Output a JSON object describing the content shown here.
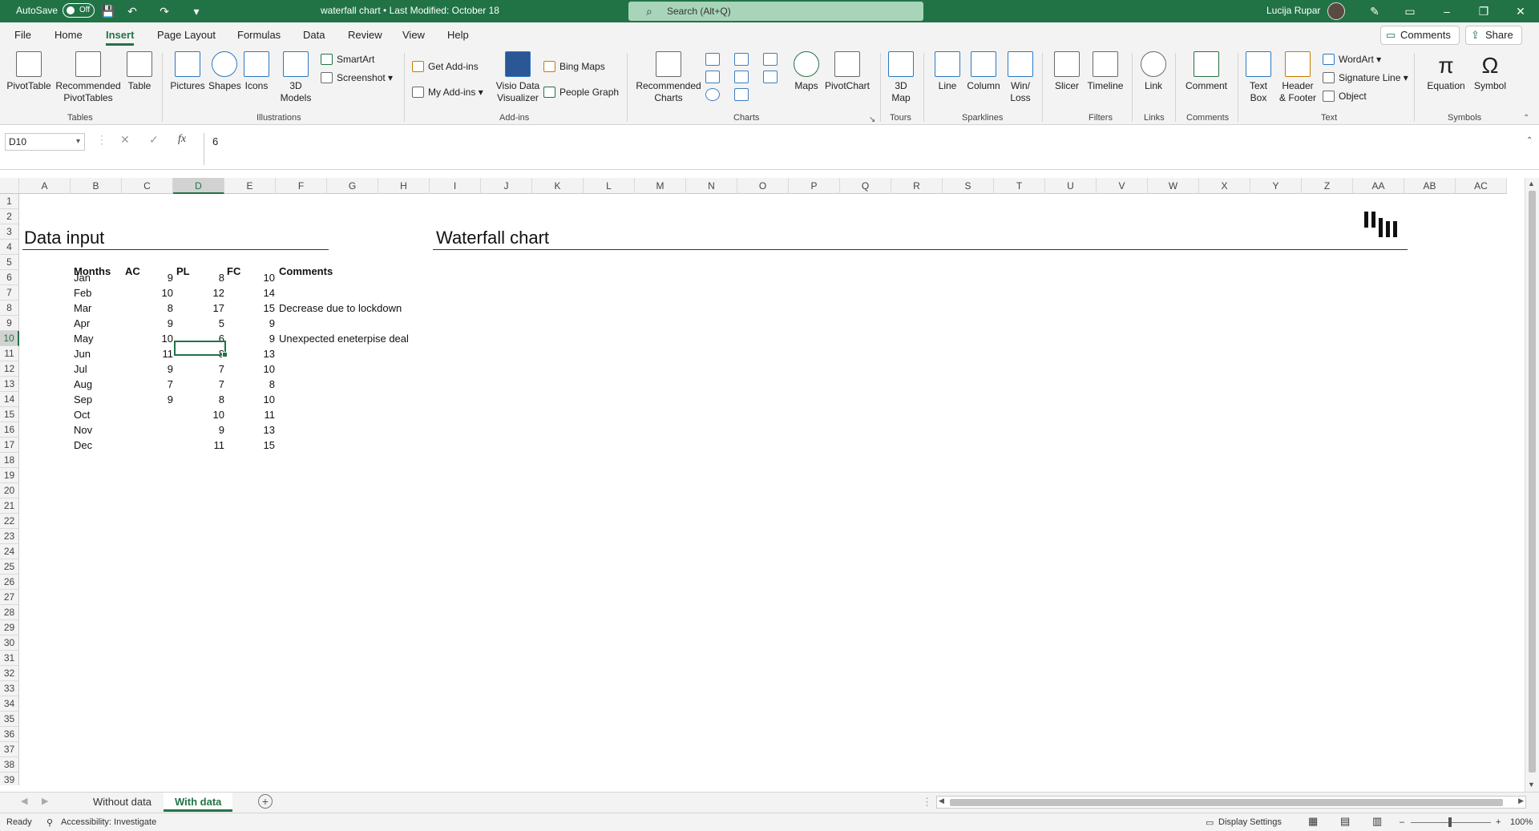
{
  "titlebar": {
    "autosave_label": "AutoSave",
    "autosave_state": "Off",
    "doc_title": "waterfall chart • Last Modified: October 18",
    "search_placeholder": "Search (Alt+Q)",
    "user_name": "Lucija Rupar"
  },
  "tabs": [
    "File",
    "Home",
    "Insert",
    "Page Layout",
    "Formulas",
    "Data",
    "Review",
    "View",
    "Help"
  ],
  "active_tab": "Insert",
  "comments_btn": "Comments",
  "share_btn": "Share",
  "ribbon": {
    "pivottable": "PivotTable",
    "recommended_pivottables_1": "Recommended",
    "recommended_pivottables_2": "PivotTables",
    "table": "Table",
    "group_tables": "Tables",
    "pictures": "Pictures",
    "shapes": "Shapes",
    "icons": "Icons",
    "models_1": "3D",
    "models_2": "Models",
    "smartart": "SmartArt",
    "screenshot": "Screenshot",
    "group_illustrations": "Illustrations",
    "get_addins": "Get Add-ins",
    "my_addins": "My Add-ins",
    "visio_1": "Visio Data",
    "visio_2": "Visualizer",
    "bing_maps": "Bing Maps",
    "people_graph": "People Graph",
    "group_addins": "Add-ins",
    "recommended_charts_1": "Recommended",
    "recommended_charts_2": "Charts",
    "maps": "Maps",
    "pivotchart": "PivotChart",
    "group_charts": "Charts",
    "map3d_1": "3D",
    "map3d_2": "Map",
    "group_tours": "Tours",
    "line": "Line",
    "column": "Column",
    "winloss_1": "Win/",
    "winloss_2": "Loss",
    "group_sparklines": "Sparklines",
    "slicer": "Slicer",
    "timeline": "Timeline",
    "group_filters": "Filters",
    "link": "Link",
    "group_links": "Links",
    "comment": "Comment",
    "group_comments": "Comments",
    "textbox_1": "Text",
    "textbox_2": "Box",
    "header_1": "Header",
    "header_2": "& Footer",
    "wordart": "WordArt",
    "signature_line": "Signature Line",
    "object": "Object",
    "group_text": "Text",
    "equation": "Equation",
    "symbol": "Symbol",
    "group_symbols": "Symbols"
  },
  "formula_bar": {
    "namebox": "D10",
    "formula": "6",
    "fx": "fx"
  },
  "columns": [
    "A",
    "B",
    "C",
    "D",
    "E",
    "F",
    "G",
    "H",
    "I",
    "J",
    "K",
    "L",
    "M",
    "N",
    "O",
    "P",
    "Q",
    "R",
    "S",
    "T",
    "U",
    "V",
    "W",
    "X",
    "Y",
    "Z",
    "AA",
    "AB",
    "AC"
  ],
  "selected_column": "D",
  "selected_row": 10,
  "sheet": {
    "data_input_title": "Data input",
    "waterfall_title": "Waterfall chart",
    "headers": {
      "months": "Months",
      "ac": "AC",
      "pl": "PL",
      "fc": "FC",
      "comments": "Comments"
    },
    "rows": [
      {
        "m": "Jan",
        "ac": "9",
        "pl": "8",
        "fc": "10",
        "c": ""
      },
      {
        "m": "Feb",
        "ac": "10",
        "pl": "12",
        "fc": "14",
        "c": ""
      },
      {
        "m": "Mar",
        "ac": "8",
        "pl": "17",
        "fc": "15",
        "c": "Decrease due to lockdown"
      },
      {
        "m": "Apr",
        "ac": "9",
        "pl": "5",
        "fc": "9",
        "c": ""
      },
      {
        "m": "May",
        "ac": "10",
        "pl": "6",
        "fc": "9",
        "c": "Unexpected eneterpise deal"
      },
      {
        "m": "Jun",
        "ac": "11",
        "pl": "8",
        "fc": "13",
        "c": ""
      },
      {
        "m": "Jul",
        "ac": "9",
        "pl": "7",
        "fc": "10",
        "c": ""
      },
      {
        "m": "Aug",
        "ac": "7",
        "pl": "7",
        "fc": "8",
        "c": ""
      },
      {
        "m": "Sep",
        "ac": "9",
        "pl": "8",
        "fc": "10",
        "c": ""
      },
      {
        "m": "Oct",
        "ac": "",
        "pl": "10",
        "fc": "11",
        "c": ""
      },
      {
        "m": "Nov",
        "ac": "",
        "pl": "9",
        "fc": "13",
        "c": ""
      },
      {
        "m": "Dec",
        "ac": "",
        "pl": "11",
        "fc": "15",
        "c": ""
      }
    ]
  },
  "sheet_tabs": [
    "Without data",
    "With data"
  ],
  "active_sheet": "With data",
  "status": {
    "ready": "Ready",
    "accessibility": "Accessibility: Investigate",
    "display_settings": "Display Settings",
    "zoom": "100%"
  }
}
